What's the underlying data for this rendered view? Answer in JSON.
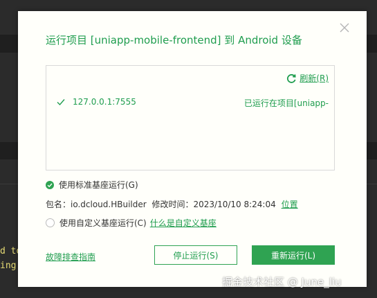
{
  "dialog": {
    "title": "运行项目 [uniapp-mobile-frontend] 到 Android 设备",
    "refresh_label": "刷新(R)",
    "devices": [
      {
        "address": "127.0.0.1:7555",
        "status": "已运行在项目[uniapp-"
      }
    ],
    "standard_base_label": "使用标准基座运行(G)",
    "package_label": "包名：io.dcloud.HBuilder",
    "modified_label": "修改时间：2023/10/10 8:24:04",
    "location_link": "位置",
    "custom_base_label": "使用自定义基座运行(C)",
    "custom_base_help_link": "什么是自定义基座",
    "troubleshoot_link": "故障排查指南",
    "stop_button": "停止运行(S)",
    "rerun_button": "重新运行(L)"
  },
  "background": {
    "code_line_1": "d to",
    "code_line_2": "ing"
  },
  "watermark": "掘金技术社区 @ June_liu",
  "colors": {
    "accent": "#1f9d4e",
    "button_fill": "#2fa352",
    "dialog_bg": "#fffffa",
    "ide_bg": "#2b2b2b"
  },
  "icons": {
    "close": "close-icon",
    "refresh": "refresh-icon",
    "check": "check-icon",
    "radio_checked": "radio-checked-icon"
  }
}
